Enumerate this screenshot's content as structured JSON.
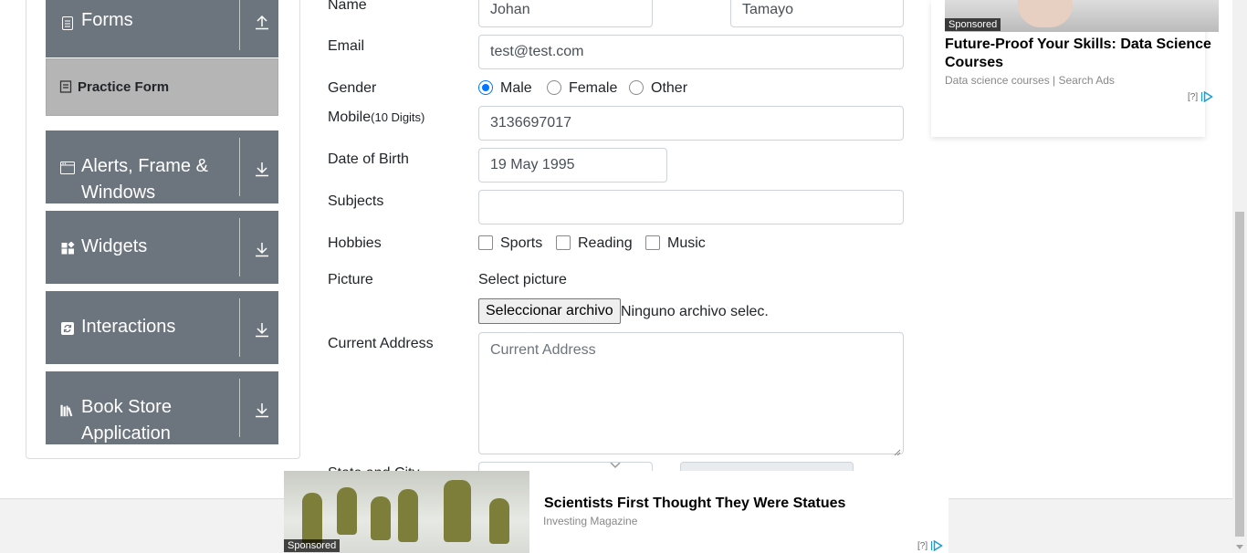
{
  "sidebar": {
    "forms": {
      "label": "Forms"
    },
    "practice_form": {
      "label": "Practice Form"
    },
    "alerts": {
      "label": "Alerts, Frame & Windows"
    },
    "widgets": {
      "label": "Widgets"
    },
    "interactions": {
      "label": "Interactions"
    },
    "bookstore": {
      "label": "Book Store Application"
    }
  },
  "form": {
    "name_label": "Name",
    "first_name": "Johan",
    "last_name": "Tamayo",
    "email_label": "Email",
    "email": "test@test.com",
    "gender_label": "Gender",
    "gender_options": [
      "Male",
      "Female",
      "Other"
    ],
    "gender_selected": "Male",
    "mobile_label": "Mobile",
    "mobile_hint": "(10 Digits)",
    "mobile": "3136697017",
    "dob_label": "Date of Birth",
    "dob": "19 May 1995",
    "subjects_label": "Subjects",
    "subjects": "",
    "hobbies_label": "Hobbies",
    "hobbies": [
      "Sports",
      "Reading",
      "Music"
    ],
    "picture_label": "Picture",
    "picture_text": "Select picture",
    "file_button": "Seleccionar archivo",
    "file_status": "Ninguno archivo selec.",
    "address_label": "Current Address",
    "address_placeholder": "Current Address",
    "state_city_label": "State and City"
  },
  "ad_right": {
    "sponsored": "Sponsored",
    "headline": "Future-Proof Your Skills: Data Science Courses",
    "source": "Data science courses | Search Ads",
    "adchoice": "[?]"
  },
  "ad_bottom": {
    "sponsored": "Sponsored",
    "headline": "Scientists First Thought They Were Statues",
    "source": "Investing Magazine",
    "adchoice": "[?]"
  },
  "colors": {
    "sidebar_group": "#6c757d",
    "practice_active": "#b5b5b5",
    "radio_accent": "#0075ff"
  }
}
